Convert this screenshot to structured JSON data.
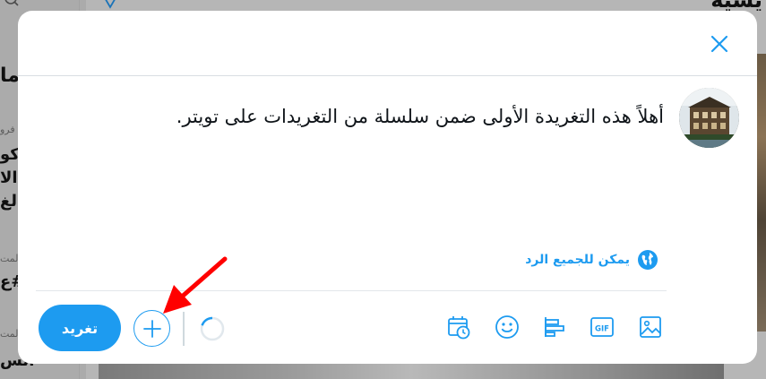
{
  "background": {
    "top_heading": "يسية",
    "left_items": [
      "ما",
      "كو",
      "الا",
      "لغ",
      "#ع",
      "الس"
    ],
    "left_small": [
      "فرو",
      "المت",
      "المت"
    ]
  },
  "composer": {
    "tweet_text": "أهلاً هذه التغريدة الأولى ضمن سلسلة من التغريدات على تويتر.",
    "reply_setting_label": "يمكن للجميع الرد",
    "tweet_button_label": "تغريد"
  },
  "toolbar": {
    "icons": [
      "image-icon",
      "gif-icon",
      "poll-icon",
      "emoji-icon",
      "schedule-icon"
    ],
    "gif_label": "GIF"
  },
  "colors": {
    "accent": "#1d9bf0",
    "annotation_arrow": "#ff0000"
  }
}
